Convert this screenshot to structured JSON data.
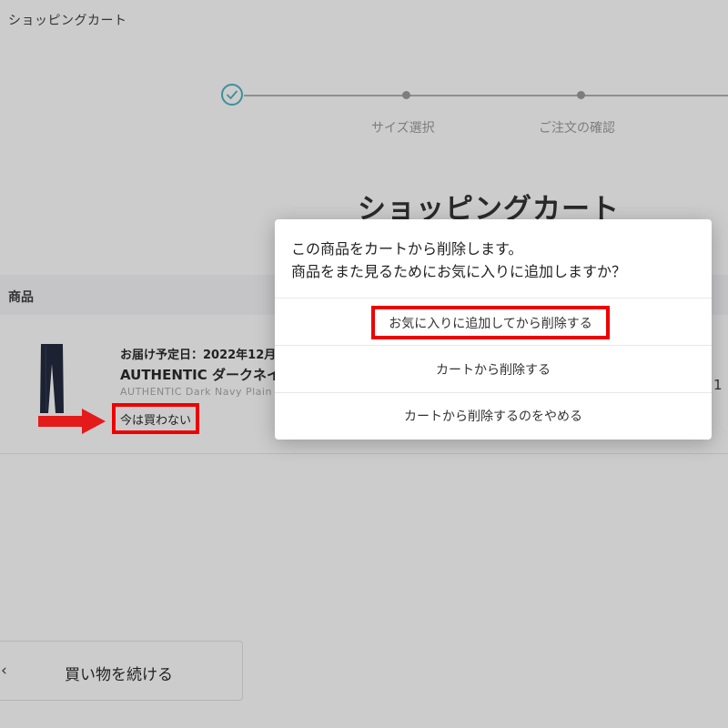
{
  "header": {
    "title": "ショッピングカート"
  },
  "stepper": {
    "steps": [
      "サイズ選択",
      "ご注文の確認"
    ]
  },
  "main": {
    "heading": "ショッピングカート",
    "table_header": "商品",
    "item": {
      "delivery": "お届け予定日：2022年12月",
      "name": "AUTHENTIC ダークネイ",
      "name_en": "AUTHENTIC Dark Navy Plain",
      "not_now_label": "今は買わない",
      "quantity": "1"
    },
    "continue": {
      "chevron": "‹",
      "label": "買い物を続ける"
    }
  },
  "modal": {
    "message_line1": "この商品をカートから削除します。",
    "message_line2": "商品をまた見るためにお気に入りに追加しますか？",
    "options": [
      "お気に入りに追加してから削除する",
      "カートから削除する",
      "カートから削除するのをやめる"
    ]
  },
  "colors": {
    "overlay": "#cccccc",
    "accent": "#3f8f9a",
    "highlight": "#ee0000"
  },
  "icons": {
    "step_done": "check-icon",
    "arrow": "right-arrow-icon"
  }
}
